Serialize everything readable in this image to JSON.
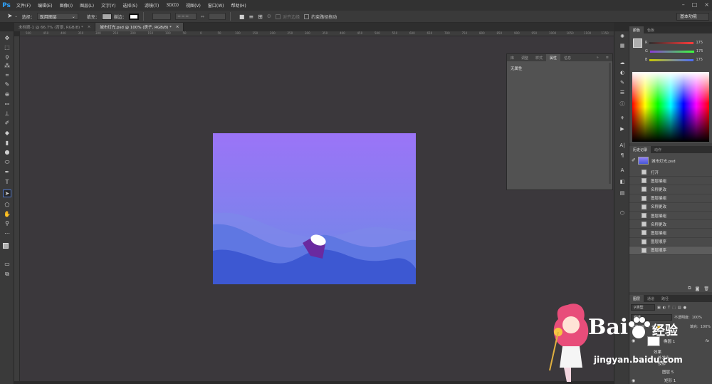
{
  "app": {
    "logo": "Ps"
  },
  "menu": [
    "文件(F)",
    "编辑(E)",
    "图像(I)",
    "图层(L)",
    "文字(Y)",
    "选择(S)",
    "滤镜(T)",
    "3D(D)",
    "视图(V)",
    "窗口(W)",
    "帮助(H)"
  ],
  "window_controls": {
    "minimize": "–",
    "maximize": "□",
    "close": "×"
  },
  "options_bar": {
    "select_label": "选择：",
    "select_value": "现用图层",
    "fill_label": "填充：",
    "stroke_label": "描边：",
    "align_edges_label": "对齐边缘",
    "constrain_label": "约束路径拖动",
    "workspace": "基本功能"
  },
  "tabs": [
    {
      "label": "未标题-1 @ 66.7% (背景, RGB/8) *",
      "close": "×"
    },
    {
      "label": "城市灯光.psd @ 100% (房子, RGB/8) *",
      "close": "×",
      "active": true
    }
  ],
  "ruler_numbers": [
    "500",
    "450",
    "400",
    "350",
    "300",
    "250",
    "200",
    "150",
    "100",
    "50",
    "0",
    "50",
    "100",
    "150",
    "200",
    "250",
    "300",
    "350",
    "400",
    "450",
    "500",
    "550",
    "600",
    "650",
    "700",
    "750",
    "800",
    "850",
    "900",
    "950",
    "1000",
    "1050",
    "1100",
    "1150"
  ],
  "tools_icons": [
    "move-icon",
    "marquee-icon",
    "lasso-icon",
    "magic-wand-icon",
    "crop-icon",
    "eyedropper-icon",
    "healing-icon",
    "brush-icon",
    "stamp-icon",
    "history-brush-icon",
    "eraser-icon",
    "gradient-icon",
    "blur-icon",
    "dodge-icon",
    "pen-icon",
    "type-icon",
    "path-select-icon",
    "shape-icon",
    "hand-icon",
    "zoom-icon",
    "more-icon"
  ],
  "properties_panel": {
    "tabs": [
      "库",
      "调整",
      "样式",
      "属性",
      "信息"
    ],
    "active_tab": "属性",
    "content": "无属性"
  },
  "color_panel": {
    "tabs": [
      "颜色",
      "色板"
    ],
    "channels": [
      {
        "label": "R",
        "value": "175",
        "color": "#ff3b3b"
      },
      {
        "label": "G",
        "value": "175",
        "color": "#3bff3b"
      },
      {
        "label": "B",
        "value": "175",
        "color": "#4b6bff"
      }
    ]
  },
  "history_panel": {
    "tabs": [
      "历史记录",
      "动作"
    ],
    "snapshot": "城市灯光.psd",
    "items": [
      "打开",
      "图层编组",
      "名称更改",
      "图层编组",
      "名称更改",
      "图层编组",
      "名称更改",
      "图层编组",
      "图层顺序",
      "图层顺序"
    ],
    "selected_index": 9
  },
  "layers_panel": {
    "tabs": [
      "图层",
      "通道",
      "路径"
    ],
    "kind_filter": "类型",
    "blend_mode": "穿透",
    "opacity_label": "不透明度:",
    "opacity": "100%",
    "lock_label": "锁定:",
    "fill_label": "填充:",
    "fill": "100%",
    "layers": [
      {
        "name": "椭圆 1",
        "fx": "fx"
      },
      {
        "name": "效果"
      },
      {
        "name": "外发光"
      },
      {
        "name": "投影"
      },
      {
        "name": "图层 5"
      },
      {
        "name": "矩形 1"
      }
    ]
  },
  "watermark": {
    "brand": "Bai",
    "brand2": "经验",
    "url": "jingyan.baidu.com"
  }
}
